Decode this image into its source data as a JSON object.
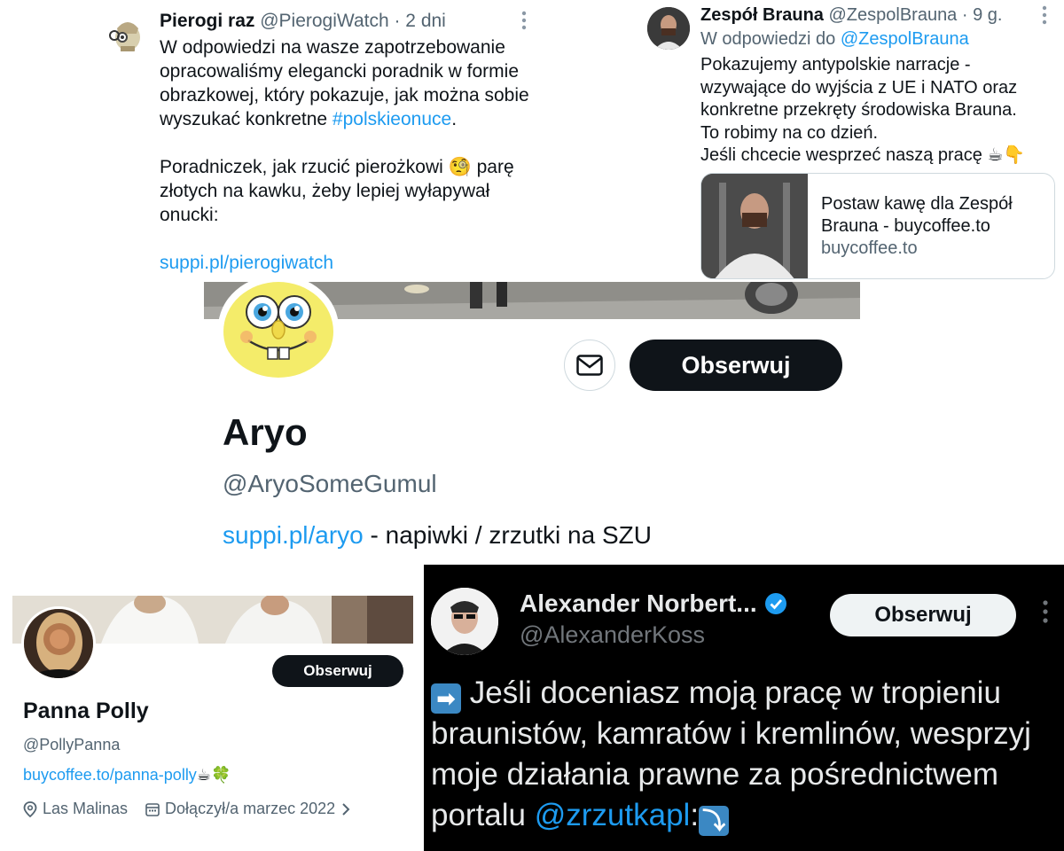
{
  "pierogi": {
    "name": "Pierogi raz",
    "handle": "@PierogiWatch",
    "time": "· 2 dni",
    "body_line1": "W odpowiedzi na wasze zapotrzebowanie",
    "body_line2": "opracowaliśmy elegancki poradnik w formie",
    "body_line3": "obrazkowej, który pokazuje, jak można sobie",
    "body_line4_prefix": "wyszukać konkretne ",
    "hashtag": "#polskieonuce",
    "body_line4_suffix": ".",
    "body2_line1_prefix": "Poradniczek, jak rzucić pierożkowi ",
    "emoji_monocle": "🧐",
    "body2_line1_suffix": " parę",
    "body2_line2": "złotych na kawku, żeby lepiej wyłapywał",
    "body2_line3": "onucki:",
    "link": "suppi.pl/pierogiwatch"
  },
  "brauna": {
    "name": "Zespół Brauna",
    "handle": "@ZespolBrauna",
    "time": "· 9 g.",
    "reply_prefix": "W odpowiedzi do ",
    "reply_handle": "@ZespolBrauna",
    "lines": [
      "Pokazujemy antypolskie narracje -",
      "wzywające do wyjścia z UE i NATO oraz",
      "konkretne przekręty środowiska Brauna.",
      "To robimy na co dzień.",
      "Jeśli chcecie wesprzeć naszą pracę ☕👇"
    ],
    "card_title": "Postaw kawę dla Zespół Brauna - buycoffee.to",
    "card_domain": "buycoffee.to"
  },
  "aryo": {
    "follow_label": "Obserwuj",
    "name": "Aryo",
    "handle": "@AryoSomeGumul",
    "bio_link": "suppi.pl/aryo",
    "bio_text": " - napiwki / zrzutki na SZU"
  },
  "polly": {
    "follow_label": "Obserwuj",
    "name": "Panna Polly",
    "handle": "@PollyPanna",
    "bio_link": "buycoffee.to/panna-polly",
    "bio_emoji": "☕🍀",
    "location": "Las Malinas",
    "joined": "Dołączył/a marzec 2022"
  },
  "alexander": {
    "name": "Alexander Norbert...",
    "handle": "@AlexanderKoss",
    "follow_label": "Obserwuj",
    "arrow_right": "➡",
    "line1": " Jeśli doceniasz moją pracę w tropieniu",
    "line2": "braunistów, kamratów i kremlinów, wesprzyj",
    "line3": "moje działania prawne za pośrednictwem",
    "line4_prefix": "portalu ",
    "mention": "@zrzutkapl",
    "line4_suffix": ":",
    "arrow_down": "⤵"
  },
  "colors": {
    "accent": "#1d9bf0",
    "verified": "#1d9bf0",
    "follow_dark": "#0f1419",
    "dark_bg": "#000000"
  }
}
